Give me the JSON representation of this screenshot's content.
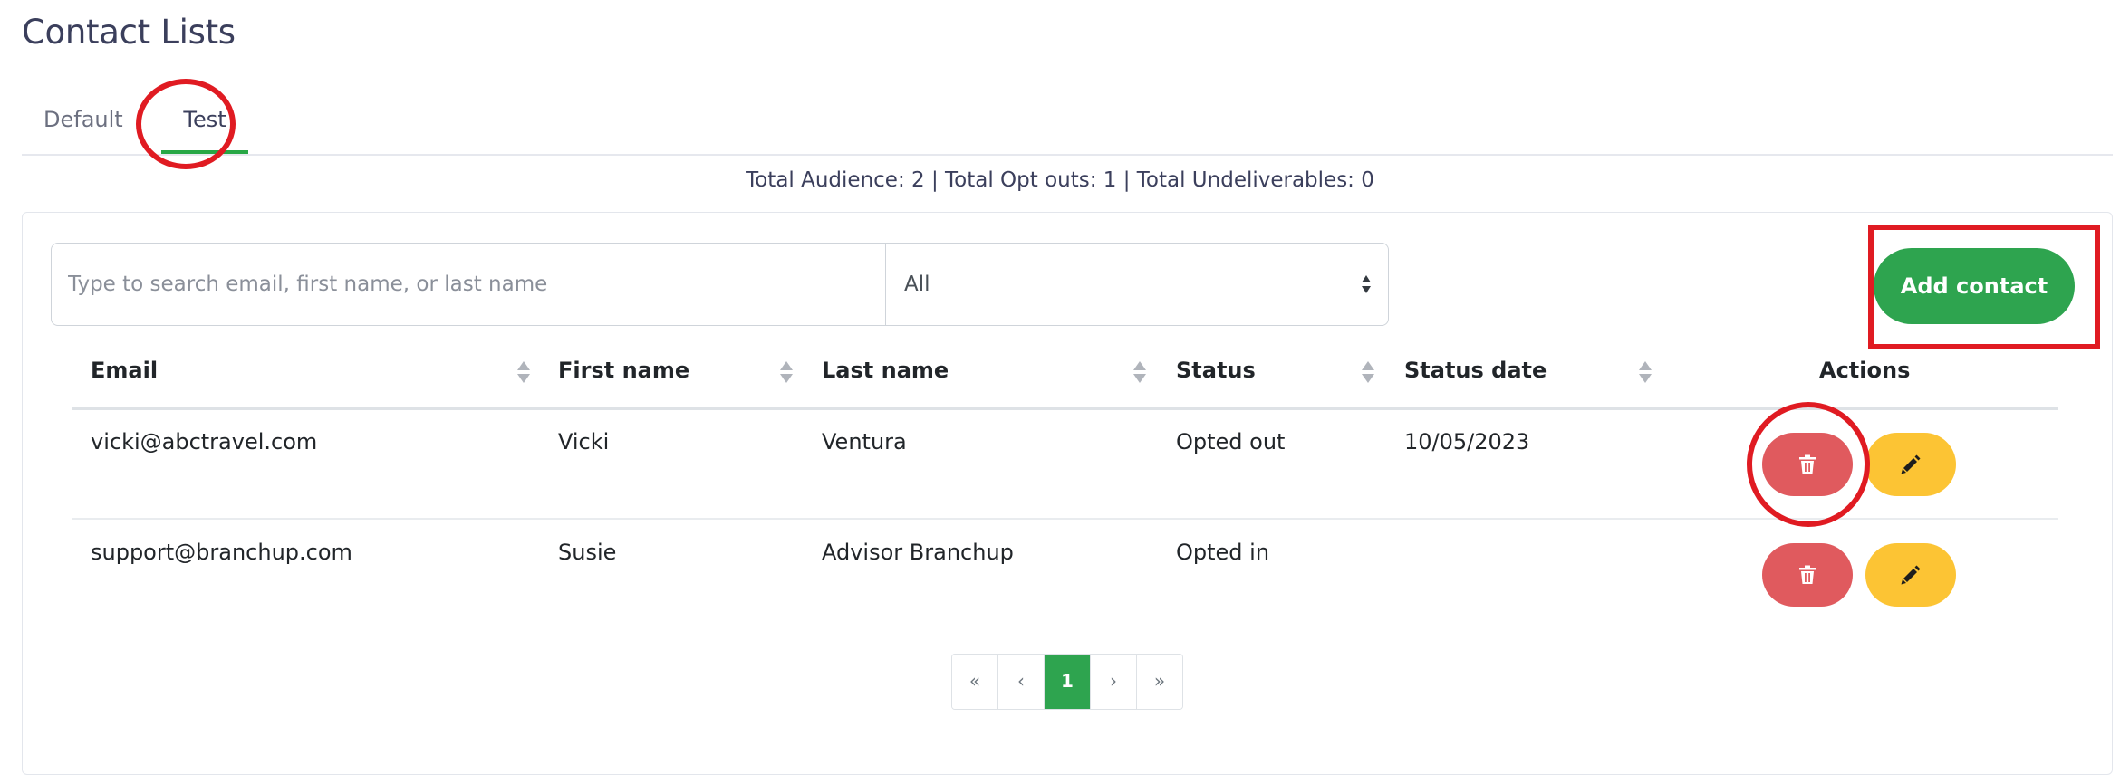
{
  "page": {
    "title": "Contact Lists"
  },
  "tabs": [
    {
      "label": "Default",
      "active": false
    },
    {
      "label": "Test",
      "active": true
    }
  ],
  "summary": "Total Audience: 2 | Total Opt outs: 1 | Total Undeliverables: 0",
  "search": {
    "placeholder": "Type to search email, first name, or last name",
    "value": ""
  },
  "filter": {
    "selected": "All"
  },
  "add_button": {
    "label": "Add contact"
  },
  "table": {
    "columns": [
      "Email",
      "First name",
      "Last name",
      "Status",
      "Status date",
      "Actions"
    ],
    "rows": [
      {
        "email": "vicki@abctravel.com",
        "first_name": "Vicki",
        "last_name": "Ventura",
        "status": "Opted out",
        "status_date": "10/05/2023"
      },
      {
        "email": "support@branchup.com",
        "first_name": "Susie",
        "last_name": "Advisor Branchup",
        "status": "Opted in",
        "status_date": ""
      }
    ]
  },
  "pagination": {
    "first": "«",
    "prev": "‹",
    "current": "1",
    "next": "›",
    "last": "»"
  },
  "icons": {
    "delete": "trash-icon",
    "edit": "pencil-icon",
    "sort": "sort-icon",
    "select": "select-arrows-icon"
  },
  "colors": {
    "accent_green": "#2ea44f",
    "delete_red": "#e05a5e",
    "edit_yellow": "#fcc434",
    "annotation_red": "#e01b22",
    "title": "#3b3f5c"
  }
}
